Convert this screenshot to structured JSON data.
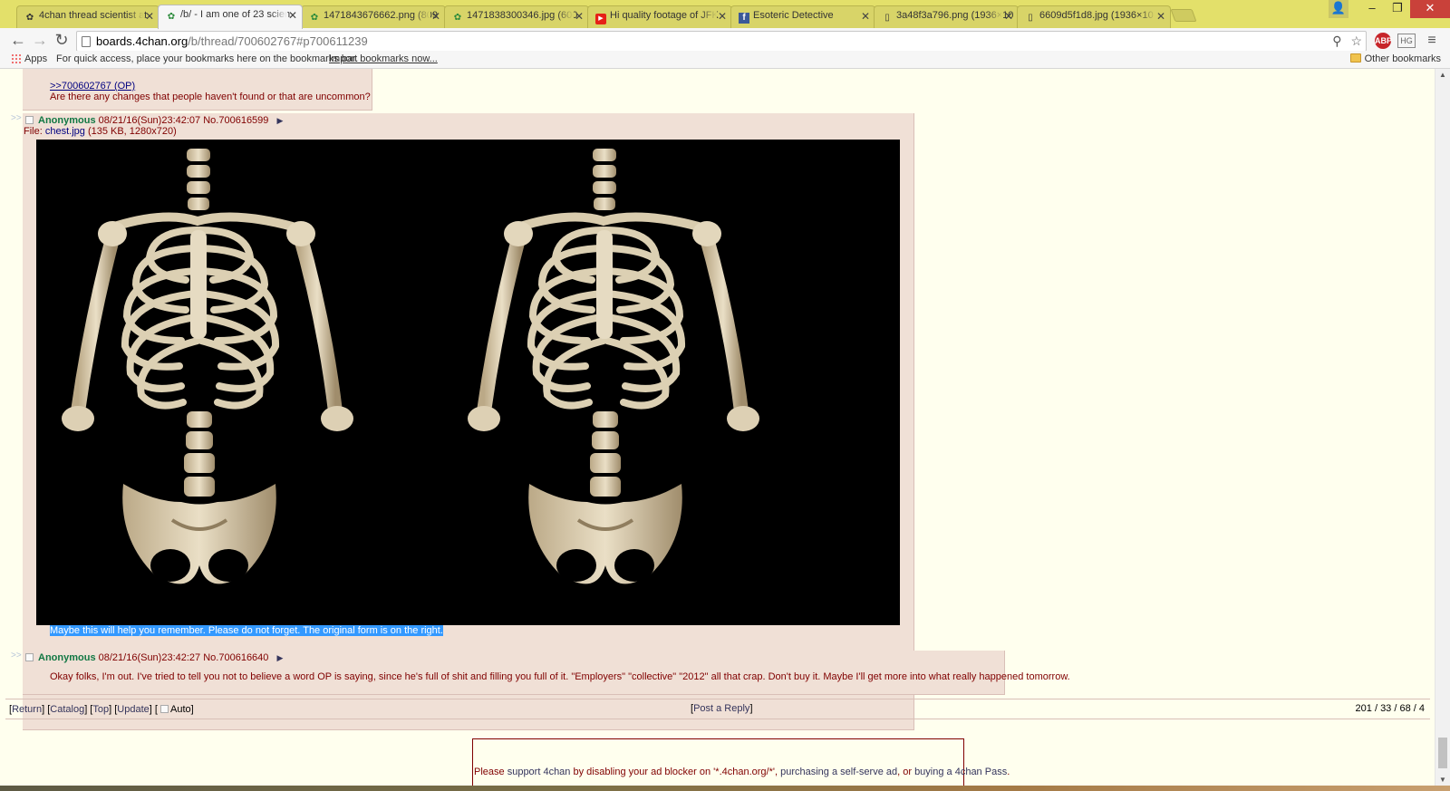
{
  "browser": {
    "tabs": [
      {
        "title": "4chan thread scientist at",
        "icon": "clover-icon"
      },
      {
        "title": "/b/ - I am one of 23 scien",
        "icon": "clover-icon",
        "active": true
      },
      {
        "title": "1471843676662.png (809",
        "icon": "clover-icon"
      },
      {
        "title": "1471838300346.jpg (600",
        "icon": "clover-icon"
      },
      {
        "title": "Hi quality footage of JFK",
        "icon": "youtube-icon"
      },
      {
        "title": "Esoteric Detective",
        "icon": "facebook-icon"
      },
      {
        "title": "3a48f3a796.png (1936×10",
        "icon": "document-icon"
      },
      {
        "title": "6609d5f1d8.jpg (1936×10",
        "icon": "document-icon"
      }
    ],
    "url_host": "boards.4chan.org",
    "url_path": "/b/thread/700602767#p700611239",
    "extension_abp_label": "ABP",
    "extension_hg_label": "HG",
    "bookmarks": {
      "apps_label": "Apps",
      "hint": "For quick access, place your bookmarks here on the bookmarks bar.",
      "import_label": "Import bookmarks now...",
      "other_label": "Other bookmarks"
    }
  },
  "thread": {
    "prev_post": {
      "quote_link": ">>700602767 (OP)",
      "message": "Are there any changes that people haven't found or that are uncommon?"
    },
    "posts": [
      {
        "name": "Anonymous",
        "date": "08/21/16(Sun)23:42:07",
        "number": "No.700616599",
        "file_label": "File:",
        "file_name": "chest.jpg",
        "file_info": "(135 KB, 1280x720)",
        "message": "Maybe this will help you remember. Please do not forget. The original form is on the right."
      },
      {
        "name": "Anonymous",
        "date": "08/21/16(Sun)23:42:27",
        "number": "No.700616640",
        "message": "Okay folks, I'm out. I've tried to tell you not to believe a word OP is saying, since he's full of shit and filling you full of it. \"Employers\" \"collective\" \"2012\" all that crap. Don't buy it. Maybe I'll get more into what really happened tomorrow."
      }
    ],
    "side_arrows": ">>",
    "menu_arrow": "▶"
  },
  "footer": {
    "return": "Return",
    "catalog": "Catalog",
    "top": "Top",
    "update": "Update",
    "auto": "Auto",
    "post_reply": "Post a Reply",
    "stats": "201 / 33 / 68 / 4"
  },
  "ad": {
    "prefix": "Please ",
    "link1": "support 4chan",
    "mid1": " by disabling your ad blocker on '*.4chan.org/*', ",
    "link2": "purchasing a self-serve ad",
    "mid2": ", or ",
    "link3": "buying a 4chan Pass",
    "suffix": "."
  }
}
